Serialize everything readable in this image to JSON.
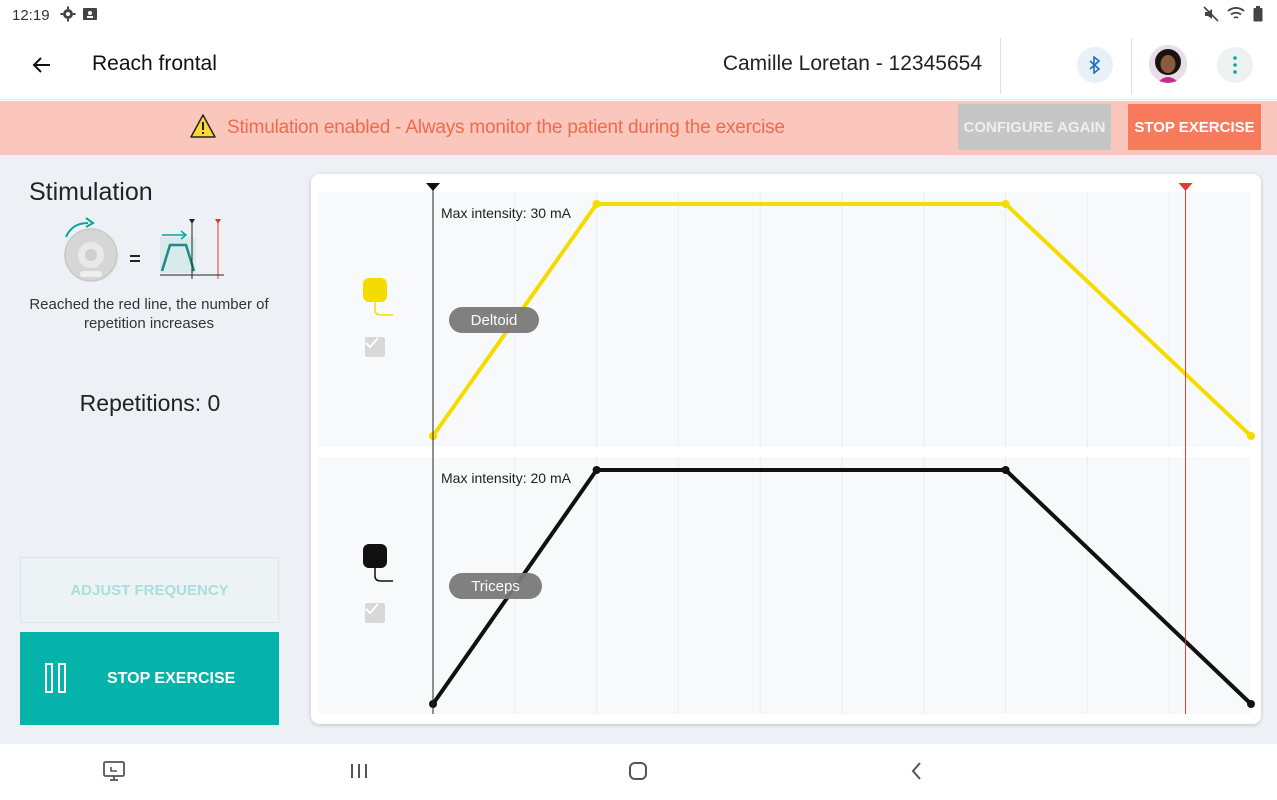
{
  "status_bar": {
    "time": "12:19"
  },
  "header": {
    "title": "Reach frontal",
    "patient": "Camille Loretan - 12345654"
  },
  "banner": {
    "message": "Stimulation enabled - Always monitor the patient during the exercise",
    "configure_label": "CONFIGURE AGAIN",
    "stop_label": "STOP EXERCISE"
  },
  "sidebar": {
    "title": "Stimulation",
    "description": "Reached the red line, the number of repetition increases",
    "repetitions": "Repetitions: 0",
    "adjust_label": "ADJUST FREQUENCY",
    "stop_label": "STOP EXERCISE"
  },
  "colors": {
    "accent_teal": "#05b3aa",
    "warning_bg": "#fbc7bc",
    "warning_text": "#ef6b4e",
    "stop_orange": "#f87a5c",
    "deltoid": "#f5dc00",
    "triceps": "#111111",
    "threshold_red": "#e53935"
  },
  "channels": [
    {
      "name": "Deltoid",
      "max_intensity": "Max intensity: 30 mA",
      "color": "#f5dc00",
      "enabled": true,
      "profile": [
        [
          0,
          0
        ],
        [
          0.2,
          1
        ],
        [
          0.7,
          1
        ],
        [
          1,
          0
        ]
      ]
    },
    {
      "name": "Triceps",
      "max_intensity": "Max intensity: 20 mA",
      "color": "#111111",
      "enabled": true,
      "profile": [
        [
          0,
          0
        ],
        [
          0.2,
          1
        ],
        [
          0.7,
          1
        ],
        [
          1,
          0
        ]
      ]
    }
  ],
  "markers": {
    "cursor_position": 0,
    "red_line_position": 0.92
  }
}
